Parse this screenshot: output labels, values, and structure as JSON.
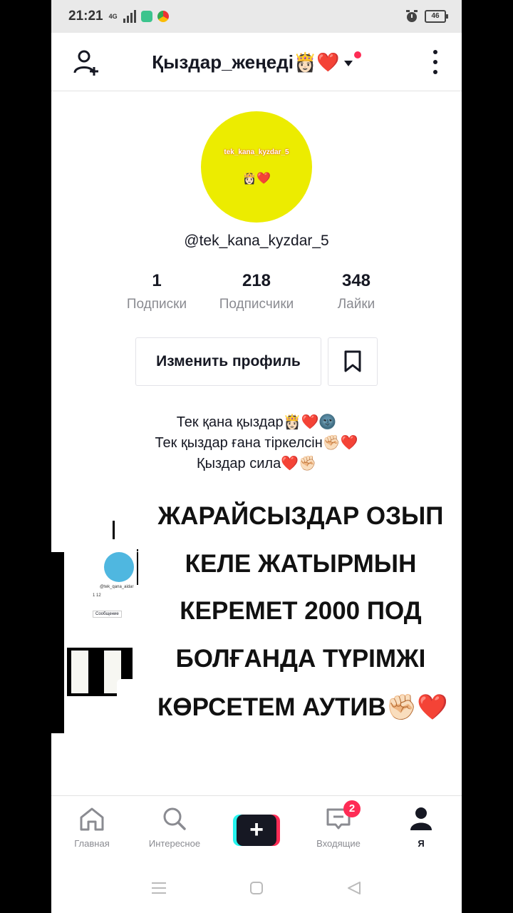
{
  "status": {
    "time": "21:21",
    "net": "4G",
    "battery": "46"
  },
  "header": {
    "title": "Қыздар_жеңеді👸🏻❤️"
  },
  "avatar": {
    "line1": "tek_kana_kyzdar_5",
    "line2": "👸🏻❤️"
  },
  "profile": {
    "handle": "@tek_kana_kyzdar_5",
    "stats": [
      {
        "value": "1",
        "label": "Подписки"
      },
      {
        "value": "218",
        "label": "Подписчики"
      },
      {
        "value": "348",
        "label": "Лайки"
      }
    ],
    "edit_label": "Изменить профиль",
    "bio": [
      "Тек қана қыздар👸🏻❤️🌚",
      "Тек қыздар ғана тіркелсін✊🏻❤️",
      "Қыздар сила❤️✊🏻"
    ]
  },
  "caption": [
    "ЖАРАЙСЫЗДАР ОЗЫП",
    "КЕЛЕ ЖАТЫРМЫН",
    "КЕРЕМЕТ 2000 ПОД",
    "БОЛҒАНДА ТҮРІМЖІ",
    "КӨРСЕТЕМ АУТИВ✊🏻❤️"
  ],
  "thumb": {
    "name": "@tek_qana_aidar",
    "stats": "1      12",
    "button": "Сообщение"
  },
  "nav": {
    "items": [
      {
        "label": "Главная",
        "icon": "home-icon"
      },
      {
        "label": "Интересное",
        "icon": "search-icon"
      },
      {
        "label": "",
        "icon": "plus-icon"
      },
      {
        "label": "Входящие",
        "icon": "inbox-icon",
        "badge": "2"
      },
      {
        "label": "Я",
        "icon": "profile-icon"
      }
    ]
  },
  "colors": {
    "accent": "#fe2c55",
    "cyan": "#25f4ee",
    "avatar_bg": "#ecec00"
  }
}
